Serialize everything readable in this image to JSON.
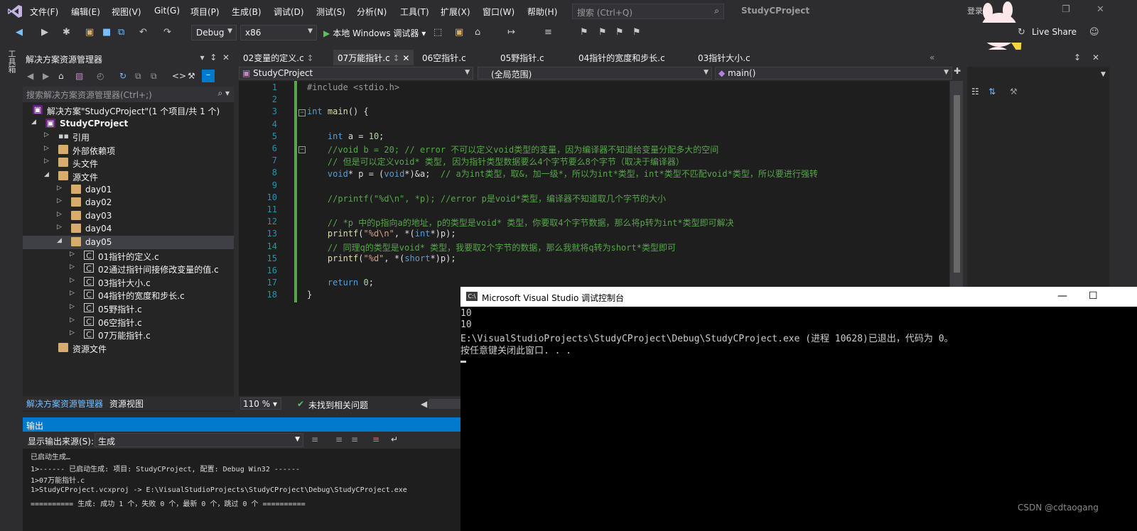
{
  "menubar": {
    "items": [
      "文件(F)",
      "编辑(E)",
      "视图(V)",
      "Git(G)",
      "项目(P)",
      "生成(B)",
      "调试(D)",
      "测试(S)",
      "分析(N)",
      "工具(T)",
      "扩展(X)",
      "窗口(W)",
      "帮助(H)"
    ],
    "search_placeholder": "搜索 (Ctrl+Q)",
    "project_title": "StudyCProject",
    "login_label": "登录"
  },
  "toolbar": {
    "config": "Debug",
    "platform": "x86",
    "run_label": "本地 Windows 调试器",
    "live_share": "Live Share"
  },
  "side_strip_label": "工具箱",
  "solution_explorer": {
    "title": "解决方案资源管理器",
    "search_placeholder": "搜索解决方案资源管理器(Ctrl+;)",
    "items": [
      {
        "label": "解决方案\"StudyCProject\"(1 个项目/共 1 个)",
        "type": "sol"
      },
      {
        "label": "StudyCProject",
        "type": "proj"
      },
      {
        "label": "引用",
        "type": "ref"
      },
      {
        "label": "外部依赖项",
        "type": "folder"
      },
      {
        "label": "头文件",
        "type": "folder"
      },
      {
        "label": "源文件",
        "type": "folder"
      },
      {
        "label": "day01",
        "type": "folder"
      },
      {
        "label": "day02",
        "type": "folder"
      },
      {
        "label": "day03",
        "type": "folder"
      },
      {
        "label": "day04",
        "type": "folder"
      },
      {
        "label": "day05",
        "type": "folder"
      },
      {
        "label": "01指针的定义.c",
        "type": "file"
      },
      {
        "label": "02通过指针间接修改变量的值.c",
        "type": "file"
      },
      {
        "label": "03指针大小.c",
        "type": "file"
      },
      {
        "label": "04指针的宽度和步长.c",
        "type": "file"
      },
      {
        "label": "05野指针.c",
        "type": "file"
      },
      {
        "label": "06空指针.c",
        "type": "file"
      },
      {
        "label": "07万能指针.c",
        "type": "file"
      },
      {
        "label": "资源文件",
        "type": "folder"
      }
    ],
    "tabs": [
      "解决方案资源管理器",
      "资源视图"
    ]
  },
  "editor": {
    "tabs": [
      "02变量的定义.c",
      "07万能指针.c",
      "06空指针.c",
      "05野指针.c",
      "04指针的宽度和步长.c",
      "03指针大小.c"
    ],
    "nav_project": "StudyCProject",
    "nav_scope": "(全局范围)",
    "nav_function": "main()",
    "zoom": "110 %",
    "status": "未找到相关问题",
    "line_numbers": [
      "1",
      "2",
      "3",
      "4",
      "5",
      "6",
      "7",
      "8",
      "9",
      "10",
      "11",
      "12",
      "13",
      "14",
      "15",
      "16",
      "17",
      "18"
    ],
    "lines": [
      "#include <stdio.h>",
      "",
      "int main() {",
      "",
      "    int a = 10;",
      "    //void b = 20; // error 不可以定义void类型的变量，因为编译器不知道给变量分配多大的空间",
      "    // 但是可以定义void* 类型, 因为指针类型数据要么4个字节要么8个字节（取决于编译器）",
      "    void* p = (void*)&a;  // a为int类型，取&，加一级*，所以为int*类型，int*类型不匹配void*类型，所以要进行强转",
      "",
      "    //printf(\"%d\\n\", *p); //error p是void*类型，编译器不知道取几个字节的大小",
      "",
      "    // *p 中的p指向a的地址，p的类型是void* 类型，你要取4个字节数据，那么将p转为int*类型即可解决",
      "    printf(\"%d\\n\", *(int*)p);",
      "    // 同理q的类型是void* 类型，我要取2个字节的数据，那么我就将q转为short*类型即可",
      "    printf(\"%d\", *(short*)p);",
      "",
      "    return 0;",
      "}"
    ]
  },
  "output": {
    "title": "输出",
    "source_label": "显示输出来源(S):",
    "source_value": "生成",
    "lines": [
      "已启动生成…",
      "1>------ 已启动生成: 项目: StudyCProject, 配置: Debug Win32 ------",
      "1>07万能指针.c",
      "1>StudyCProject.vcxproj -> E:\\VisualStudioProjects\\StudyCProject\\Debug\\StudyCProject.exe",
      "========== 生成: 成功 1 个，失败 0 个，最新 0 个，跳过 0 个 =========="
    ]
  },
  "console": {
    "title": "Microsoft Visual Studio 调试控制台",
    "icon_text": "C:\\",
    "lines": [
      "10",
      "10",
      "E:\\VisualStudioProjects\\StudyCProject\\Debug\\StudyCProject.exe (进程 10628)已退出，代码为 0。",
      "按任意键关闭此窗口. . ."
    ]
  },
  "watermark": "CSDN @cdtaogang"
}
